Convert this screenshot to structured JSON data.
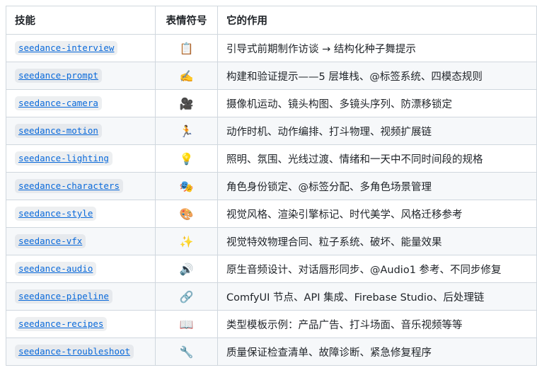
{
  "table": {
    "headers": [
      "技能",
      "表情符号",
      "它的作用"
    ],
    "rows": [
      {
        "skill": "seedance-interview",
        "emoji": "📋",
        "description": "引导式前期制作访谈 → 结构化种子舞提示"
      },
      {
        "skill": "seedance-prompt",
        "emoji": "✍️",
        "description": "构建和验证提示——5 层堆栈、@标签系统、四模态规则"
      },
      {
        "skill": "seedance-camera",
        "emoji": "🎥",
        "description": "摄像机运动、镜头构图、多镜头序列、防漂移锁定"
      },
      {
        "skill": "seedance-motion",
        "emoji": "🏃",
        "description": "动作时机、动作编排、打斗物理、视频扩展链"
      },
      {
        "skill": "seedance-lighting",
        "emoji": "💡",
        "description": "照明、氛围、光线过渡、情绪和一天中不同时间段的规格"
      },
      {
        "skill": "seedance-characters",
        "emoji": "🎭",
        "description": "角色身份锁定、@标签分配、多角色场景管理"
      },
      {
        "skill": "seedance-style",
        "emoji": "🎨",
        "description": "视觉风格、渲染引擎标记、时代美学、风格迁移参考"
      },
      {
        "skill": "seedance-vfx",
        "emoji": "✨",
        "description": "视觉特效物理合同、粒子系统、破坏、能量效果"
      },
      {
        "skill": "seedance-audio",
        "emoji": "🔊",
        "description": "原生音频设计、对话唇形同步、@Audio1 参考、不同步修复"
      },
      {
        "skill": "seedance-pipeline",
        "emoji": "🔗",
        "description": "ComfyUI 节点、API 集成、Firebase Studio、后处理链"
      },
      {
        "skill": "seedance-recipes",
        "emoji": "📖",
        "description": "类型模板示例：产品广告、打斗场面、音乐视频等等"
      },
      {
        "skill": "seedance-troubleshoot",
        "emoji": "🔧",
        "description": "质量保证检查清单、故障诊断、紧急修复程序"
      }
    ]
  }
}
